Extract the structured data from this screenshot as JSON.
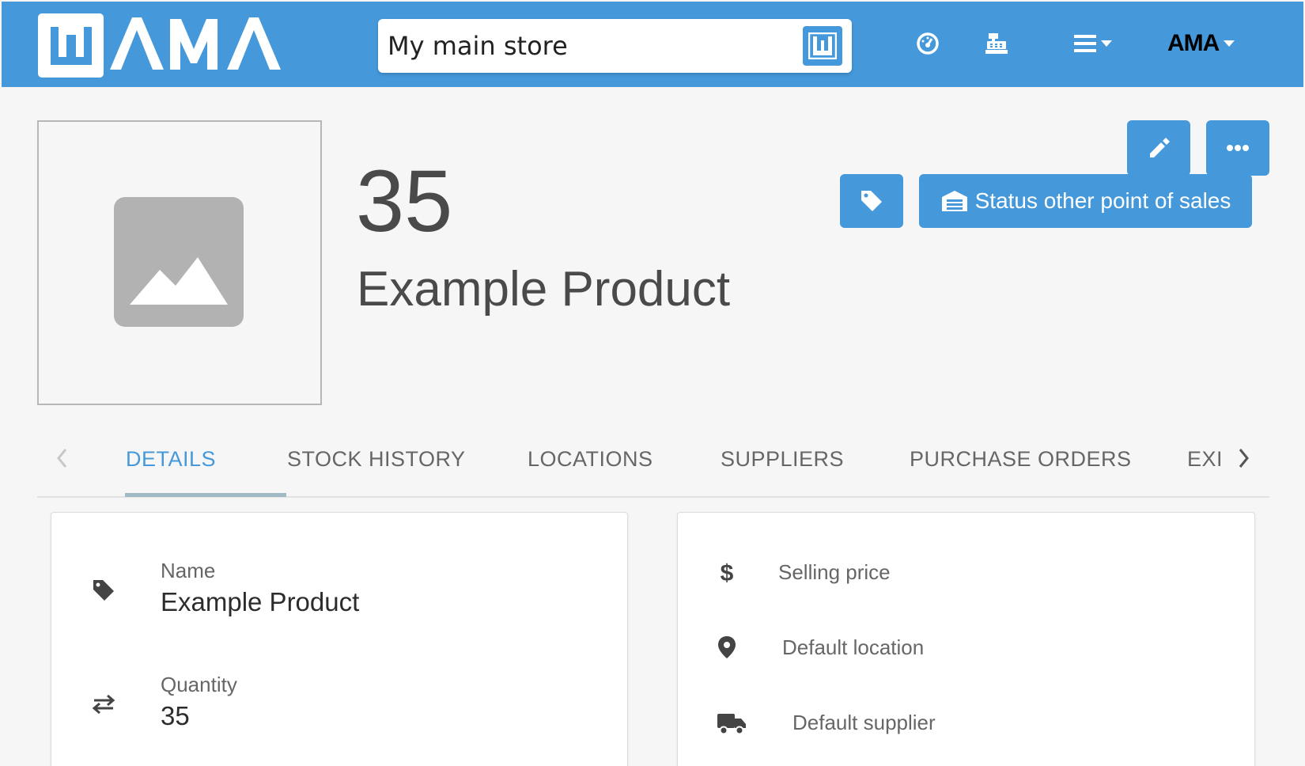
{
  "header": {
    "logo_text": "WAMA",
    "store_name": "My main store",
    "user_logo_text": "AMA"
  },
  "product": {
    "quantity": "35",
    "name": "Example Product"
  },
  "actions": {
    "status_label": "Status other point of sales"
  },
  "tabs": [
    {
      "label": "DETAILS",
      "active": true
    },
    {
      "label": "STOCK HISTORY",
      "active": false
    },
    {
      "label": "LOCATIONS",
      "active": false
    },
    {
      "label": "SUPPLIERS",
      "active": false
    },
    {
      "label": "PURCHASE ORDERS",
      "active": false
    },
    {
      "label": "EXI",
      "active": false
    }
  ],
  "details": {
    "name_label": "Name",
    "name_value": "Example Product",
    "quantity_label": "Quantity",
    "quantity_value": "35",
    "selling_price_label": "Selling price",
    "default_location_label": "Default location",
    "default_supplier_label": "Default supplier"
  },
  "colors": {
    "brand_blue": "#4599db",
    "background": "#f6f6f6",
    "text_dark": "#4a4a4a",
    "tab_active": "#4599db"
  },
  "icons": {
    "nav": [
      "speedometer-icon",
      "cash-register-icon",
      "menu-icon",
      "user-menu"
    ],
    "header_buttons": [
      "pencil-icon",
      "more-dots-icon",
      "tag-icon",
      "store-icon"
    ],
    "fields": [
      "tag-icon",
      "swap-arrows-icon",
      "dollar-icon",
      "map-pin-icon",
      "truck-icon"
    ]
  }
}
